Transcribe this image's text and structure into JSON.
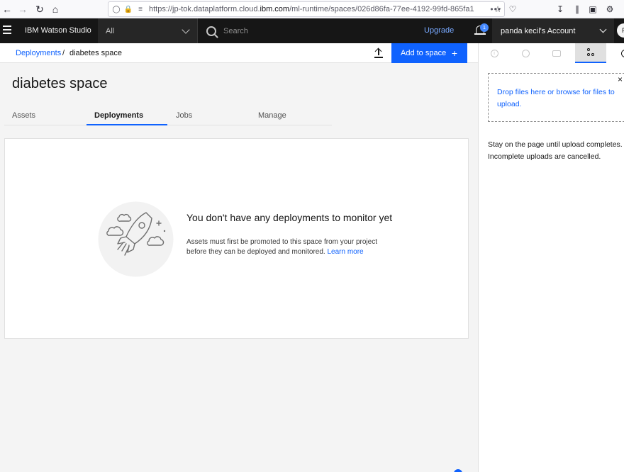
{
  "browser": {
    "url_prefix": "https://jp-tok.dataplatform.cloud.",
    "url_domain": "ibm.com",
    "url_suffix": "/ml-runtime/spaces/026d86fa-77ee-4192-99fd-865fa1",
    "more": "•••"
  },
  "header": {
    "brand": "IBM Watson Studio",
    "scope": "All",
    "search_placeholder": "Search",
    "upgrade": "Upgrade",
    "notification_count": "1",
    "account": "panda kecil's Account",
    "avatar_initial": "P"
  },
  "breadcrumb": {
    "parent": "Deployments",
    "separator": "/",
    "current": "diabetes space"
  },
  "toolbar": {
    "add_label": "Add to space",
    "add_plus": "+"
  },
  "page": {
    "title": "diabetes space",
    "tabs": [
      {
        "label": "Assets"
      },
      {
        "label": "Deployments"
      },
      {
        "label": "Jobs"
      },
      {
        "label": "Manage"
      }
    ]
  },
  "empty_state": {
    "title": "You don't have any deployments to monitor yet",
    "description": "Assets must first be promoted to this space from your project before they can be deployed and monitored.",
    "link": "Learn more"
  },
  "right_panel": {
    "dropzone_text": "Drop files here or browse for files to upload.",
    "close": "×",
    "note": "Stay on the page until upload completes. Incomplete uploads are cancelled.",
    "info_glyph": "i"
  },
  "colors": {
    "accent": "#0f62fe",
    "header_bg": "#161616",
    "link": "#0f62fe"
  }
}
